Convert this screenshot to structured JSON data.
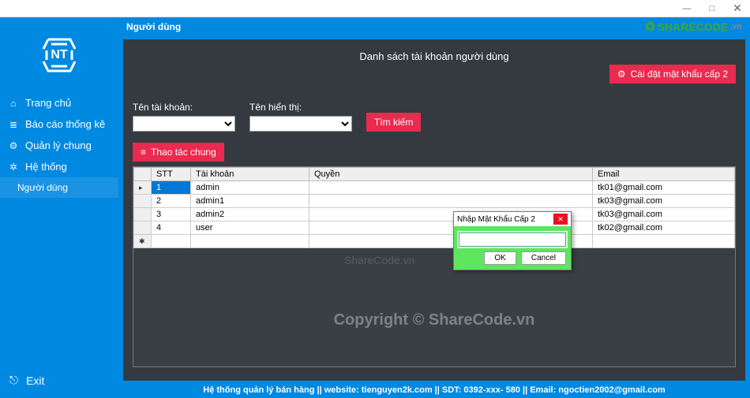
{
  "window": {
    "minimize": "—",
    "maximize": "□",
    "close": "✕"
  },
  "branding": {
    "sharecode_main": "SHARECODE",
    "sharecode_tail": ".vn"
  },
  "sidebar": {
    "logo_text": "NT",
    "items": [
      {
        "icon": "⌂",
        "label": "Trang chủ"
      },
      {
        "icon": "≣",
        "label": "Báo cáo thống kê"
      },
      {
        "icon": "⚙",
        "label": "Quản lý chung"
      },
      {
        "icon": "✲",
        "label": "Hệ thống"
      }
    ],
    "active_sub": "Người dùng",
    "exit_label": "Exit",
    "exit_icon": "⎋"
  },
  "header": {
    "title": "Người dùng"
  },
  "main": {
    "title": "Danh sách tài khoản người dùng",
    "config_btn": "Cài đặt mật khẩu cấp 2",
    "filter": {
      "account_label": "Tên tài khoản:",
      "display_label": "Tên hiển thị:",
      "search_label": "Tìm kiếm"
    },
    "batch_label": "Thao tác chung",
    "table": {
      "columns": [
        "STT",
        "Tài khoản",
        "Quyền",
        "Email"
      ],
      "rows": [
        {
          "stt": "1",
          "acc": "admin",
          "role": "",
          "email": "tk01@gmail.com"
        },
        {
          "stt": "2",
          "acc": "admin1",
          "role": "",
          "email": "tk03@gmail.com"
        },
        {
          "stt": "3",
          "acc": "admin2",
          "role": "",
          "email": "tk03@gmail.com"
        },
        {
          "stt": "4",
          "acc": "user",
          "role": "",
          "email": "tk02@gmail.com"
        }
      ]
    }
  },
  "modal": {
    "title": "Nhập Mật Khẩu Cấp 2",
    "ok": "OK",
    "cancel": "Cancel"
  },
  "footer": "Hệ thống quản lý bán hàng || website: tienguyen2k.com ||   SDT: 0392-xxx- 580 || Email: ngoctien2002@gmail.com",
  "watermark_big": "Copyright © ShareCode.vn",
  "watermark_small": "ShareCode.vn"
}
